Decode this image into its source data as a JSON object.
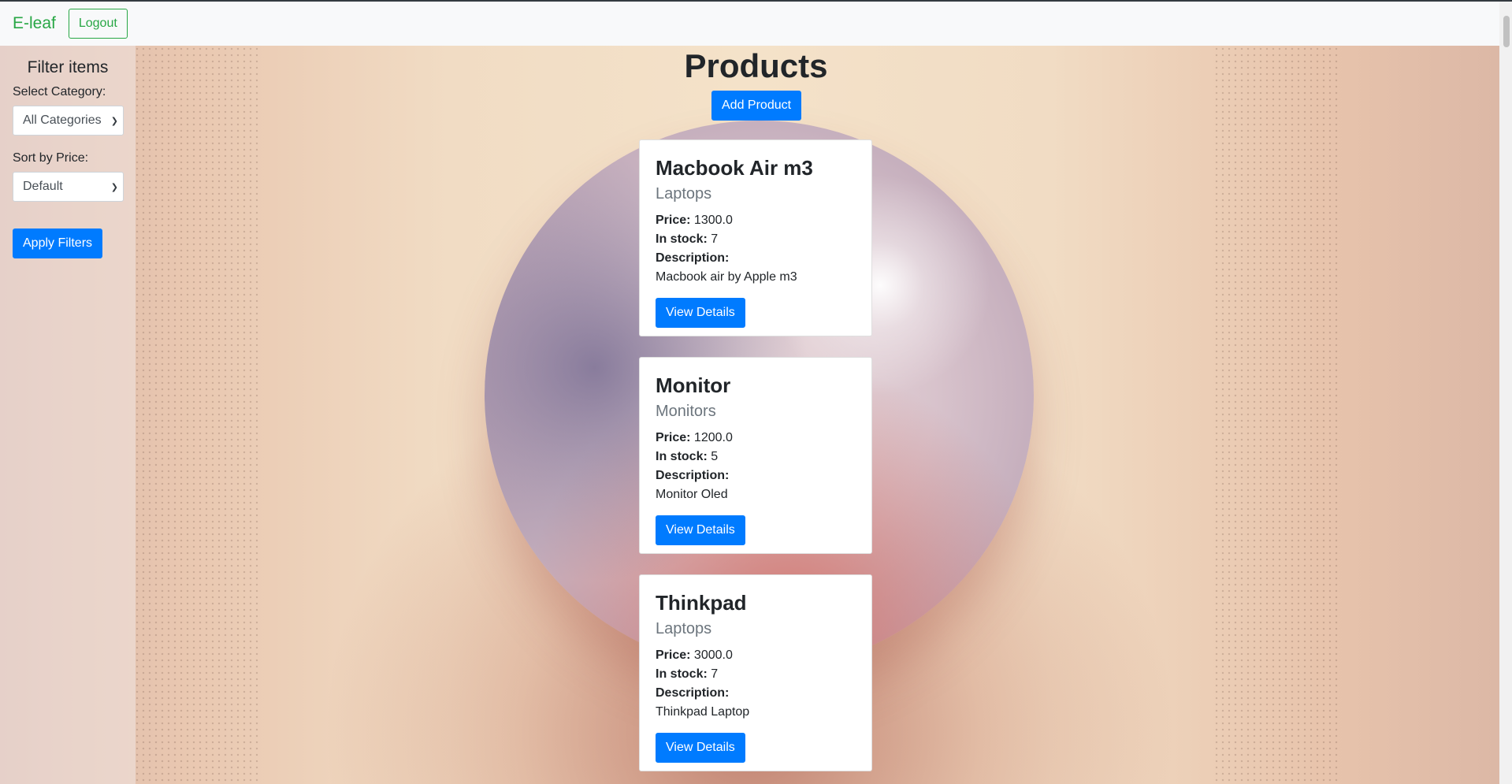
{
  "navbar": {
    "brand": "E-leaf",
    "logout_label": "Logout"
  },
  "sidebar": {
    "title": "Filter items",
    "category_label": "Select Category:",
    "category_value": "All Categories",
    "sort_label": "Sort by Price:",
    "sort_value": "Default",
    "apply_label": "Apply Filters"
  },
  "main": {
    "title": "Products",
    "add_label": "Add Product"
  },
  "labels": {
    "price": "Price:",
    "stock": "In stock:",
    "description": "Description:",
    "view_details": "View Details"
  },
  "products": [
    {
      "name": "Macbook Air m3",
      "category": "Laptops",
      "price": "1300.0",
      "stock": "7",
      "description": "Macbook air by Apple m3"
    },
    {
      "name": "Monitor",
      "category": "Monitors",
      "price": "1200.0",
      "stock": "5",
      "description": "Monitor Oled"
    },
    {
      "name": "Thinkpad",
      "category": "Laptops",
      "price": "3000.0",
      "stock": "7",
      "description": "Thinkpad Laptop"
    }
  ],
  "colors": {
    "brand": "#28a745",
    "primary": "#007bff"
  }
}
